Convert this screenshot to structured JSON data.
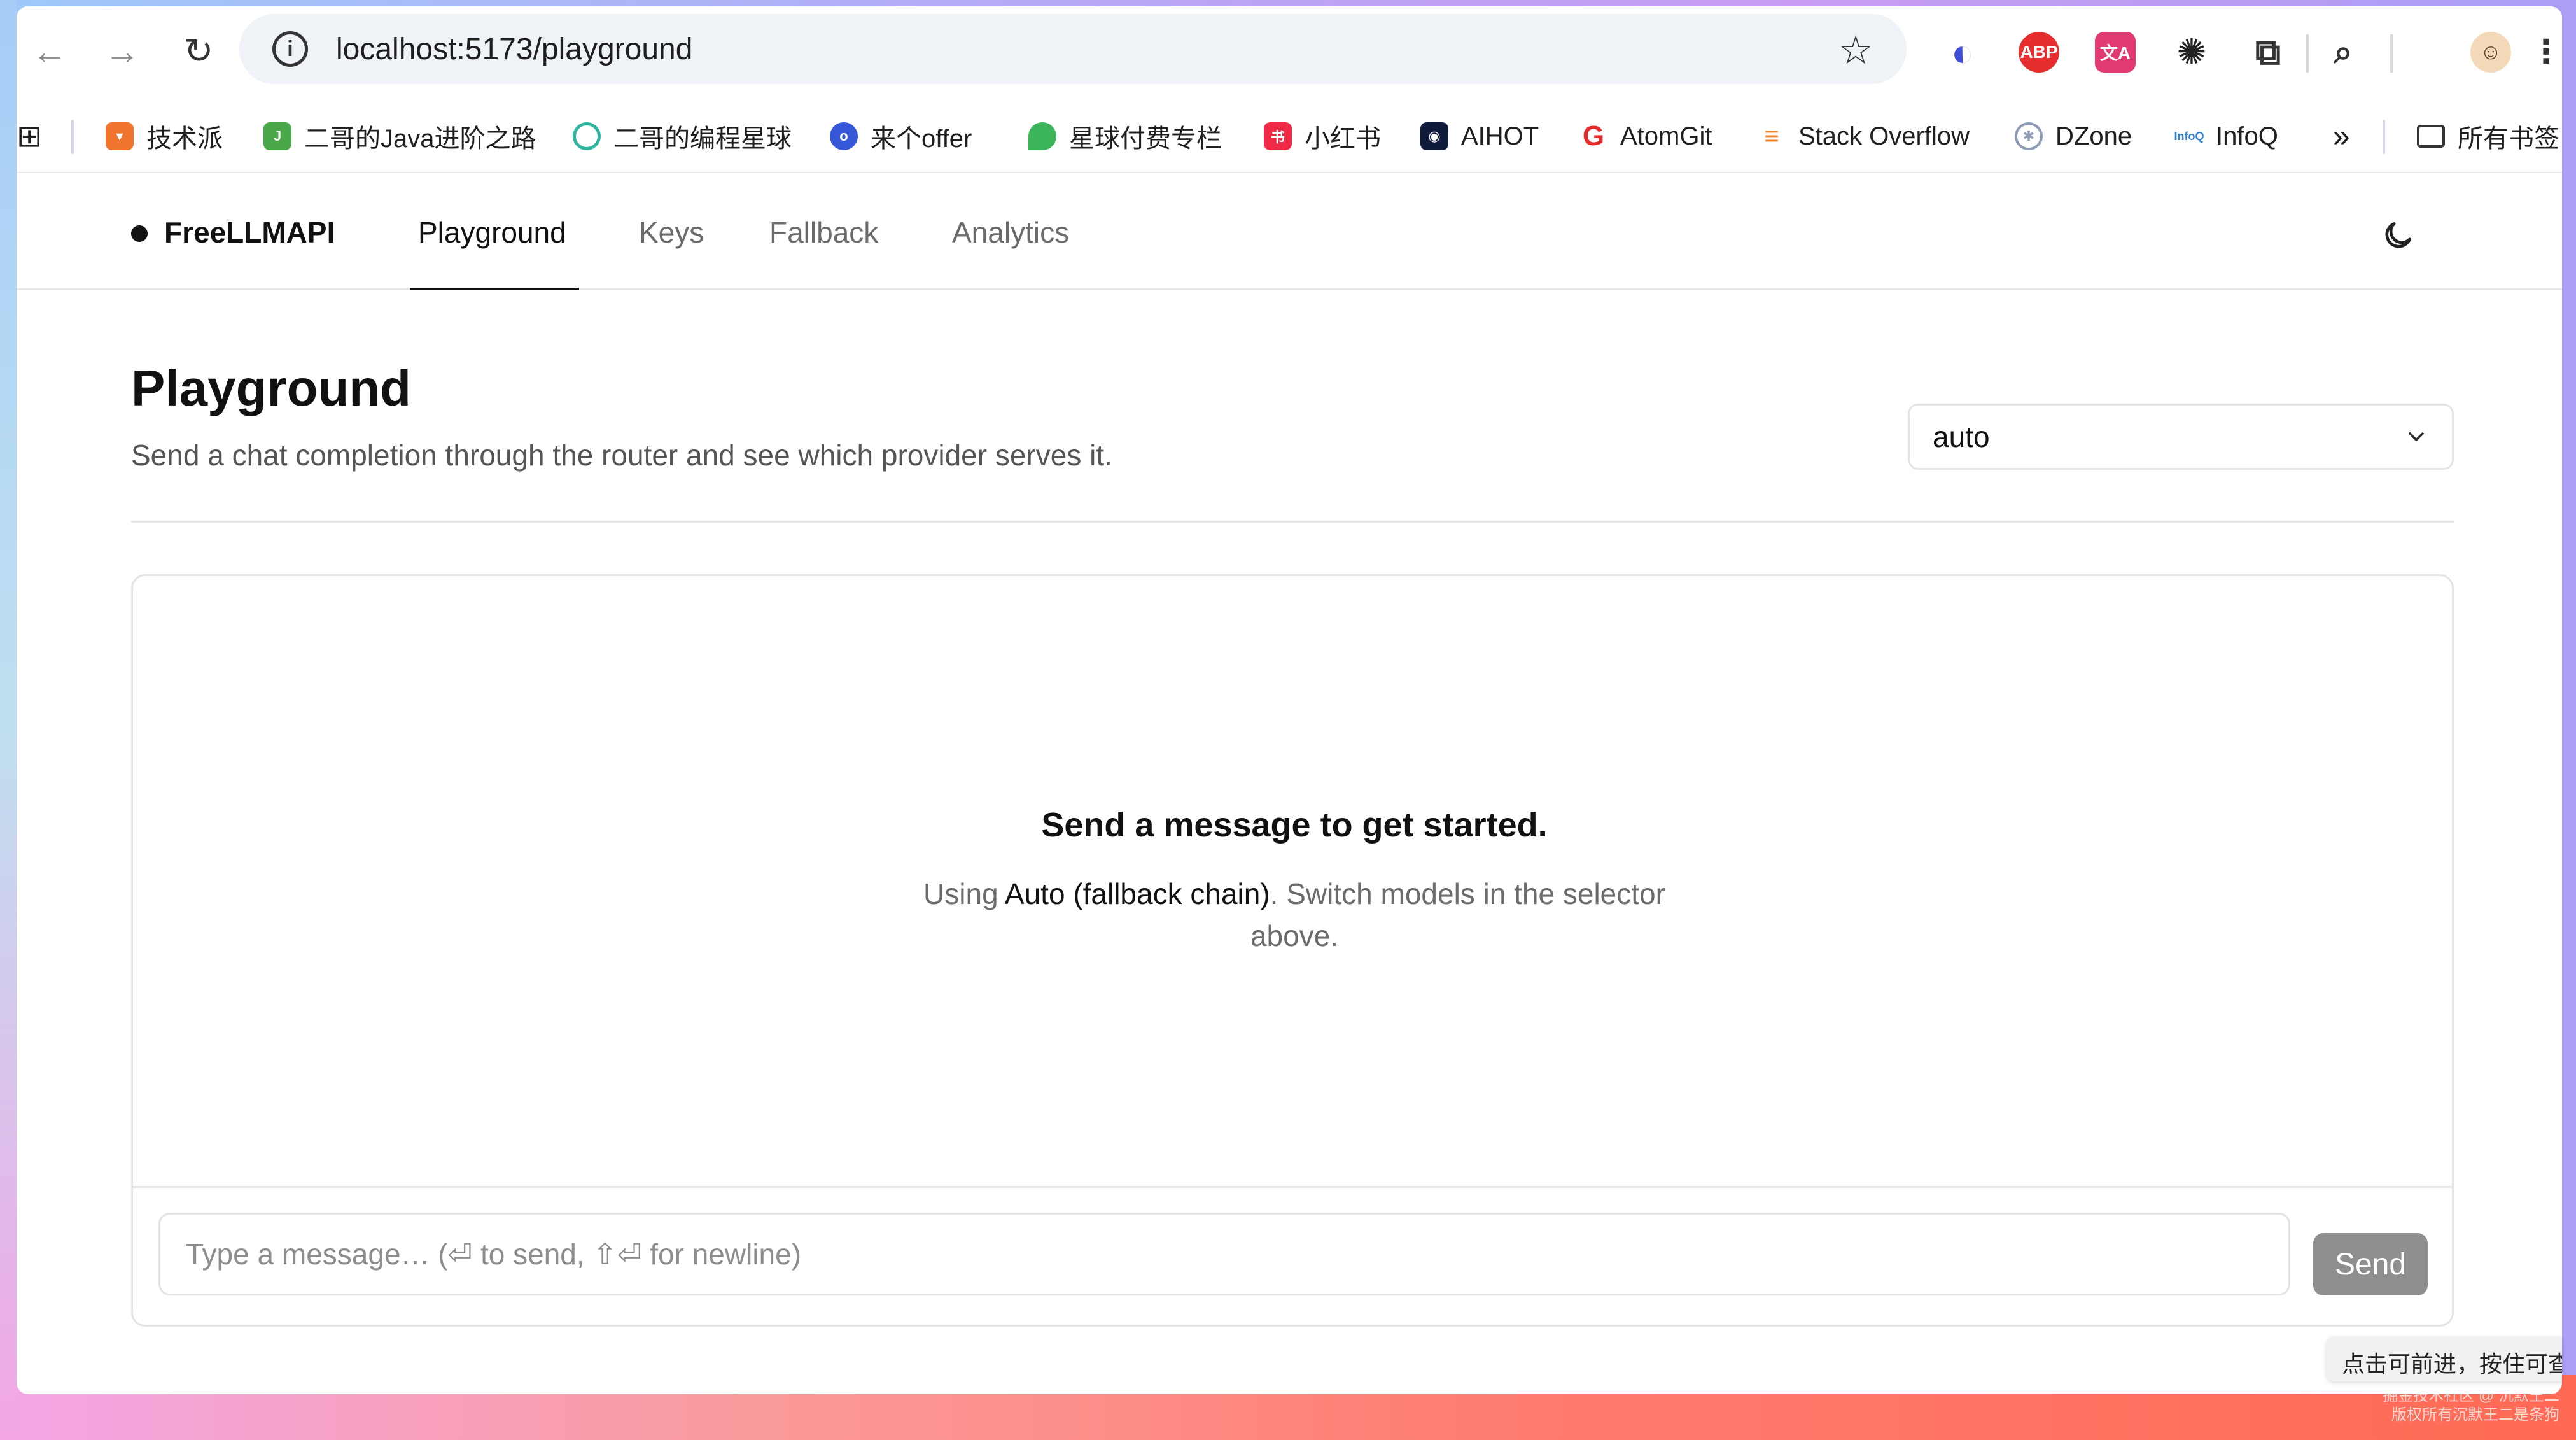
{
  "browser": {
    "url": "localhost:5173/playground",
    "extensions": [
      {
        "icon": "arc-logo-icon",
        "label": "",
        "color": "#3d4bd6"
      },
      {
        "icon": "adblock-icon",
        "label": "ABP",
        "color": "#e62e2e"
      },
      {
        "icon": "translate-icon",
        "label": "文A",
        "color": "#e23b74"
      },
      {
        "icon": "openai-icon",
        "label": "",
        "color": "#222222"
      },
      {
        "icon": "puzzle-icon",
        "label": "",
        "color": "#333333"
      }
    ]
  },
  "bookmarks": [
    {
      "label": "技术派",
      "icon": "jishupai-icon",
      "color": "#f0742e"
    },
    {
      "label": "二哥的Java进阶之路",
      "icon": "java-icon",
      "color": "#4aa84b"
    },
    {
      "label": "二哥的编程星球",
      "icon": "ring-icon",
      "color": "#2fb5a0"
    },
    {
      "label": "来个offer",
      "icon": "offer-icon",
      "color": "#3557d8"
    },
    {
      "label": "星球付费专栏",
      "icon": "leaf-icon",
      "color": "#3cb55a"
    },
    {
      "label": "小红书",
      "icon": "xiaohongshu-icon",
      "color": "#ee2a46"
    },
    {
      "label": "AIHOT",
      "icon": "aihot-icon",
      "color": "#101a3a"
    },
    {
      "label": "AtomGit",
      "icon": "atomgit-icon",
      "color": "#e02c2c"
    },
    {
      "label": "Stack Overflow",
      "icon": "stackoverflow-icon",
      "color": "#f48024"
    },
    {
      "label": "DZone",
      "icon": "dzone-icon",
      "color": "#8d9bb5"
    },
    {
      "label": "InfoQ",
      "icon": "infoq-icon",
      "color": "#2f7fd1"
    }
  ],
  "bookmarks_folder": "所有书签",
  "app": {
    "brand": "FreeLLMAPI",
    "tabs": [
      "Playground",
      "Keys",
      "Fallback",
      "Analytics"
    ],
    "active_tab": "Playground"
  },
  "page": {
    "title": "Playground",
    "subtitle": "Send a chat completion through the router and see which provider serves it.",
    "model_selected": "auto"
  },
  "chat": {
    "empty_title": "Send a message to get started.",
    "empty_prefix": "Using ",
    "empty_model": "Auto (fallback chain)",
    "empty_suffix": ". Switch models in the selector above.",
    "input_placeholder": "Type a message… (⏎ to send, ⇧⏎ for newline)",
    "send_label": "Send"
  },
  "overlay": {
    "tooltip": "点击可前进，按住可查",
    "watermark_line1": "掘金技术社区 @ 沉默王二",
    "watermark_line2": "版权所有沉默王二是条狗"
  },
  "colors": {
    "accent": "#111111",
    "muted_text": "#6b6b6b",
    "send_disabled": "#8f8f8f",
    "border": "#e4e4e4"
  }
}
